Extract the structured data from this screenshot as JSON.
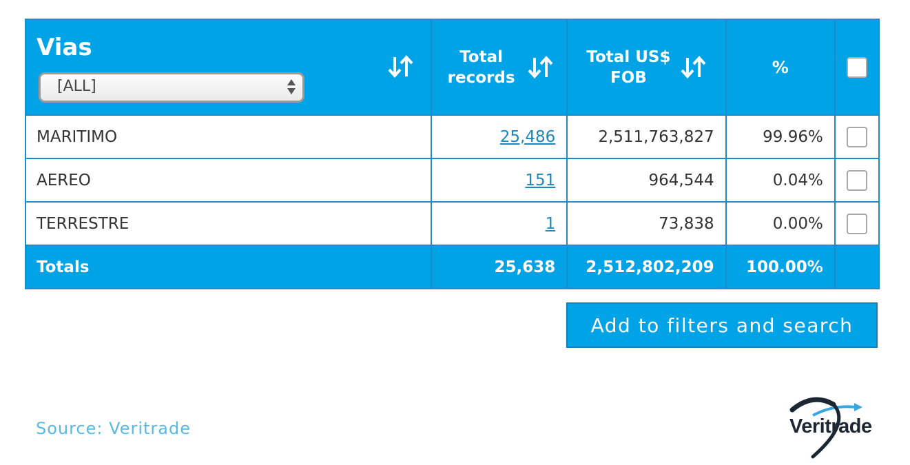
{
  "header": {
    "vias_title": "Vias",
    "vias_select_value": "[ALL]",
    "total_records_label": "Total records",
    "total_fob_label_line1": "Total US$",
    "total_fob_label_line2": "FOB",
    "percent_label": "%",
    "sort_icon": "sort-arrows-icon"
  },
  "rows": [
    {
      "name": "MARITIMO",
      "records": "25,486",
      "fob": "2,511,763,827",
      "percent": "99.96%"
    },
    {
      "name": "AEREO",
      "records": "151",
      "fob": "964,544",
      "percent": "0.04%"
    },
    {
      "name": "TERRESTRE",
      "records": "1",
      "fob": "73,838",
      "percent": "0.00%"
    }
  ],
  "totals": {
    "label": "Totals",
    "records": "25,638",
    "fob": "2,512,802,209",
    "percent": "100.00%"
  },
  "actions": {
    "add_button_label": "Add to filters and search"
  },
  "footer": {
    "source": "Source: Veritrade",
    "logo_text": "Veritrade"
  },
  "colors": {
    "header_blue": "#00a3e6",
    "border_blue": "#1a8cc9",
    "link_blue": "#1f86b8",
    "source_blue": "#5bb8e2"
  }
}
